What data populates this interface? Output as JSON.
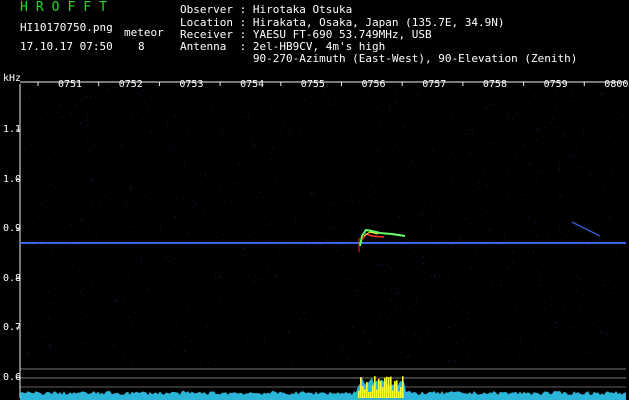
{
  "header": {
    "app_title": "HROFFT",
    "file_name": "HI10170750.png",
    "timestamp": "17.10.17 07:50",
    "meteor_label": "meteor",
    "meteor_count": "8"
  },
  "info": {
    "observer": "Observer : Hirotaka Otsuka",
    "location": "Location : Hirakata, Osaka, Japan (135.7E, 34.9N)",
    "receiver": "Receiver : YAESU FT-690 53.749MHz, USB",
    "antenna": "Antenna  : 2el-HB9CV, 4m's high",
    "antenna_detail": "           90-270-Azimuth (East-West), 90-Elevation (Zenith)"
  },
  "axis": {
    "unit": "kHz",
    "time_ticks": [
      "0751",
      "0752",
      "0753",
      "0754",
      "0755",
      "0756",
      "0757",
      "0758",
      "0759",
      "0800"
    ],
    "freq_ticks": [
      "1.1",
      "1.0",
      "0.9",
      "0.8",
      "0.7",
      "0.6"
    ]
  },
  "colors": {
    "background": "#000000",
    "noise": "#1a2a6e",
    "carrier": "#3f6fff",
    "echo_green": "#66ff66",
    "echo_yellow": "#ffff33",
    "echo_red": "#ff3333",
    "level_cyan": "#33d6ff",
    "tick": "#f0f0f0",
    "app_title": "#22dd22"
  }
}
